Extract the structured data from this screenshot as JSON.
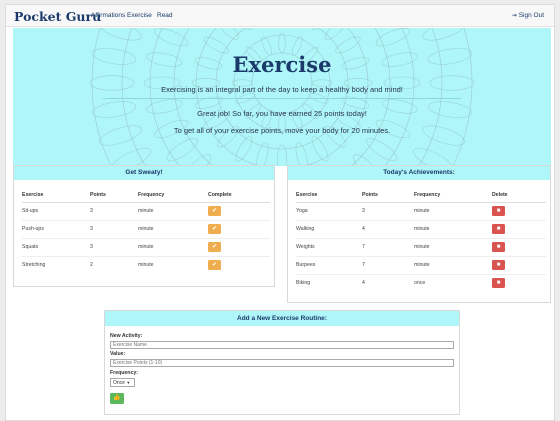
{
  "nav": {
    "brand": "Pocket Guru",
    "links": [
      "Affirmations",
      "Exercise",
      "Read"
    ],
    "signout": "Sign Out"
  },
  "hero": {
    "title": "Exercise",
    "line1": "Exercising is an integral part of the day to keep a healthy body and mind!",
    "line2": "Great job! So far, you have earned 25 points today!",
    "line3": "To get all of your exercise points, move your body for 20 minutes."
  },
  "sweaty": {
    "title": "Get Sweaty!",
    "headers": [
      "Exercise",
      "Points",
      "Frequency",
      "Complete"
    ],
    "rows": [
      [
        "Sit-ups",
        "3",
        "minute"
      ],
      [
        "Push-ups",
        "3",
        "minute"
      ],
      [
        "Squats",
        "3",
        "minute"
      ],
      [
        "Stretching",
        "2",
        "minute"
      ]
    ]
  },
  "achievements": {
    "title": "Today's Achievements:",
    "headers": [
      "Exercise",
      "Points",
      "Frequency",
      "Delete"
    ],
    "rows": [
      [
        "Yoga",
        "3",
        "minute"
      ],
      [
        "Walking",
        "4",
        "minute"
      ],
      [
        "Weights",
        "7",
        "minute"
      ],
      [
        "Burpees",
        "7",
        "minute"
      ],
      [
        "Biking",
        "4",
        "once"
      ]
    ]
  },
  "form": {
    "title": "Add a New Exercise Routine:",
    "activity_label": "New Activity:",
    "activity_placeholder": "Exercise Name",
    "value_label": "Value:",
    "value_placeholder": "Exercise Points (1-10)",
    "frequency_label": "Frequency:",
    "frequency_value": "Once"
  },
  "colors": {
    "accent": "#aef6f8",
    "brand": "#1b3a6b",
    "warning": "#f0ad4e",
    "danger": "#d9534f",
    "success": "#5cb85c"
  },
  "icons": {
    "complete": "check-icon",
    "delete": "trash-icon",
    "submit": "thumbs-up-icon",
    "signout": "sign-out-icon"
  }
}
